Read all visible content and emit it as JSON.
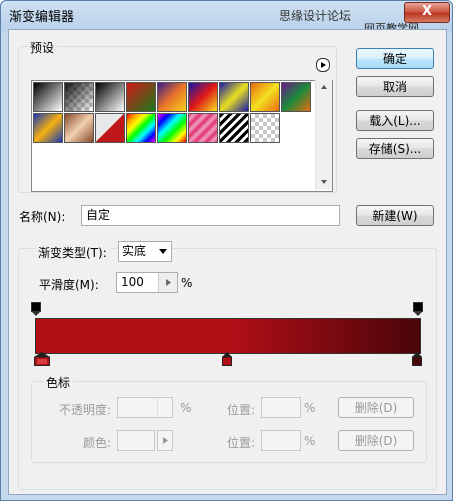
{
  "window": {
    "title": "渐变编辑器",
    "watermark": "思缘设计论坛",
    "watermark2": "网页教学网",
    "help_icon": "?",
    "close_icon": "X"
  },
  "presets": {
    "label": "预设",
    "menu_icon": "▸",
    "swatches": [
      {
        "css": "linear-gradient(135deg,#000,#fff)"
      },
      {
        "css": "checker-dark"
      },
      {
        "css": "linear-gradient(135deg,#000 0%,#fff 100%)"
      },
      {
        "css": "linear-gradient(135deg,#d01818,#1a7a1a)"
      },
      {
        "css": "linear-gradient(135deg,#3a1a8a,#e8742a,#f5d020)"
      },
      {
        "css": "linear-gradient(135deg,#1018a8,#e01818,#f5e020)"
      },
      {
        "css": "linear-gradient(135deg,#1a1aa8,#e8e020,#1a1aa8)"
      },
      {
        "css": "linear-gradient(135deg,#e86a10,#f5e020,#e86a10)"
      },
      {
        "css": "linear-gradient(135deg,#6a1a8a,#1a8a3a,#e86a10)"
      },
      {
        "css": "linear-gradient(135deg,#1a3ab0,#f5b010,#1a3ab0)"
      },
      {
        "css": "linear-gradient(135deg,#8a4a2a,#f0d0b0,#8a4a2a)"
      },
      {
        "css": "linear-gradient(135deg,#e8e8e8 49%,#c01818 50%)"
      },
      {
        "css": "linear-gradient(135deg,red,orange,yellow,lime,cyan,blue,magenta)"
      },
      {
        "css": "linear-gradient(135deg,#f0f,#00f,#0ff,#0f0,#ff0,#f00)"
      },
      {
        "css": "repeating-linear-gradient(135deg,#e03070 0,#f0a0c0 4px,#e03070 8px)"
      },
      {
        "css": "repeating-linear-gradient(135deg,#000 0,#000 3px,#fff 3px,#fff 6px)"
      },
      {
        "css": "checker-light"
      }
    ]
  },
  "buttons": {
    "ok": "确定",
    "cancel": "取消",
    "load": "载入(L)...",
    "save": "存储(S)...",
    "new": "新建(W)"
  },
  "name_field": {
    "label": "名称(N):",
    "value": "自定"
  },
  "gradient_type": {
    "label": "渐变类型(T):",
    "value": "实底"
  },
  "smoothness": {
    "label": "平滑度(M):",
    "value": "100",
    "unit": "%"
  },
  "color_stops": {
    "group_label": "色标",
    "opacity_label": "不透明度:",
    "opacity_unit": "%",
    "location_label": "位置:",
    "location_unit": "%",
    "delete_label": "删除(D)",
    "color_label": "颜色:",
    "location2_label": "位置:",
    "location2_unit": "%",
    "delete2_label": "删除(D)"
  },
  "gradient": {
    "colors": [
      "#b30f16",
      "#b30f16",
      "#4a050a"
    ],
    "color_stop_positions": [
      0,
      50,
      100
    ],
    "opacity_stop_positions": [
      0,
      100
    ]
  }
}
